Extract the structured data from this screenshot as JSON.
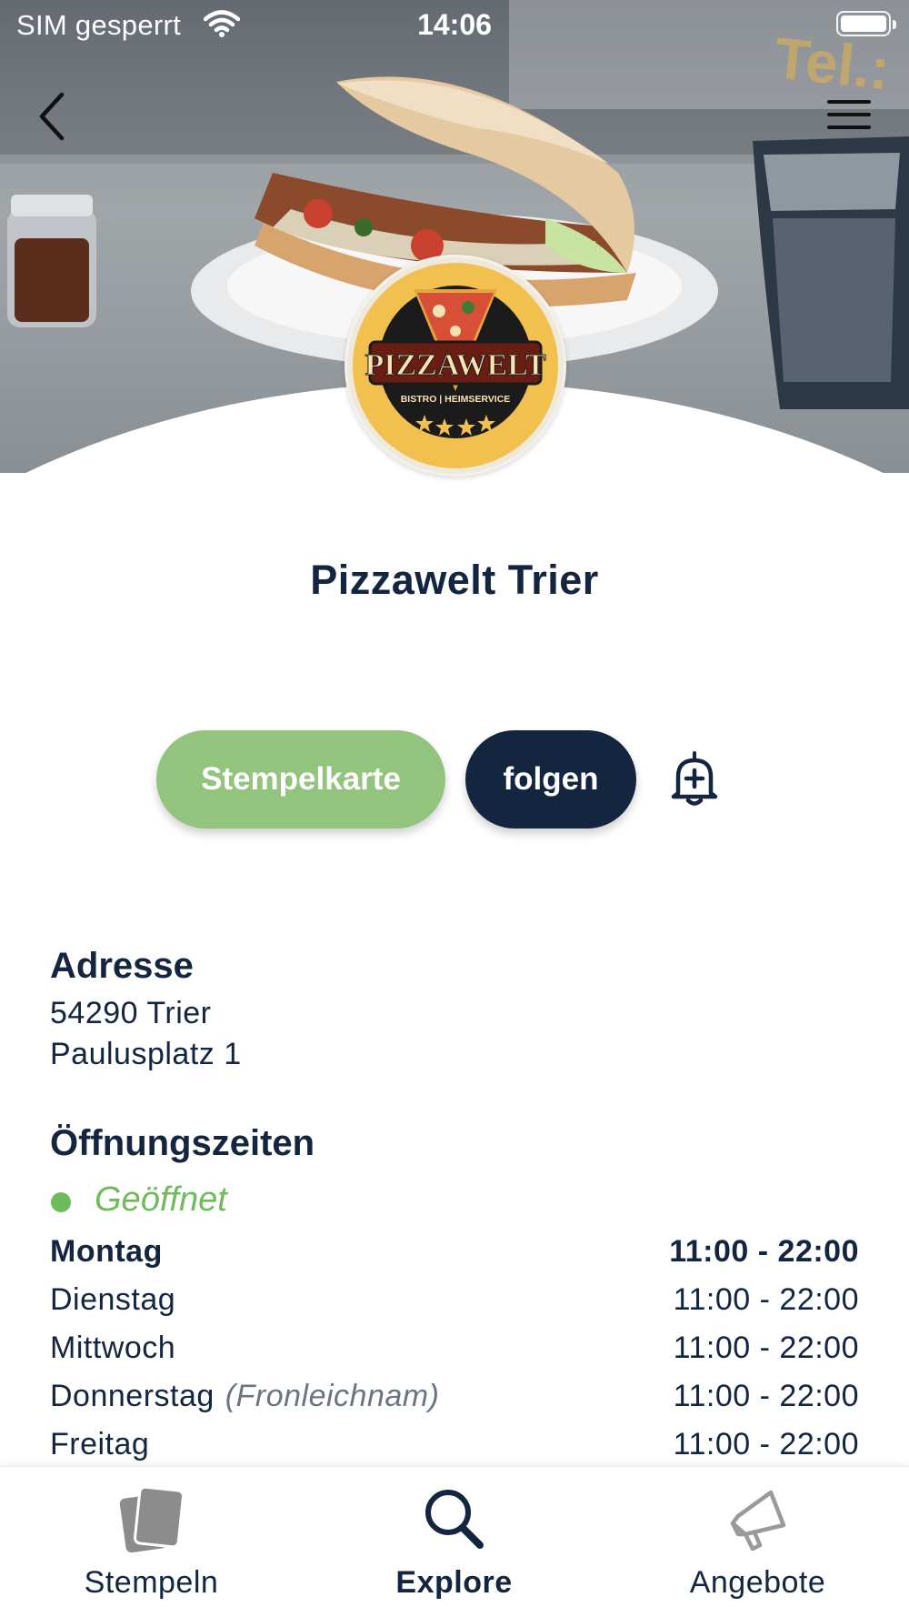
{
  "status_bar": {
    "carrier": "SIM gesperrt",
    "time": "14:06",
    "battery_level": 0.9
  },
  "nav": {
    "back_icon": "chevron-left-icon",
    "menu_icon": "hamburger-menu-icon"
  },
  "business": {
    "name": "Pizzawelt Trier",
    "logo": {
      "wordmark": "PIZZAWELT",
      "tagline": "BISTRO | HEIMSERVICE",
      "stars": 4
    }
  },
  "actions": {
    "stamp_card_label": "Stempelkarte",
    "follow_label": "folgen",
    "notify_icon": "bell-plus-icon"
  },
  "address": {
    "title": "Adresse",
    "line1": "54290 Trier",
    "line2": "Paulusplatz 1"
  },
  "opening_hours": {
    "title": "Öffnungszeiten",
    "status": "Geöffnet",
    "status_color": "#6fba5a",
    "days": [
      {
        "day": "Montag",
        "note": "",
        "hours": "11:00 - 22:00"
      },
      {
        "day": "Dienstag",
        "note": "",
        "hours": "11:00 - 22:00"
      },
      {
        "day": "Mittwoch",
        "note": "",
        "hours": "11:00 - 22:00"
      },
      {
        "day": "Donnerstag",
        "note": "(Fronleichnam)",
        "hours": "11:00 - 22:00"
      },
      {
        "day": "Freitag",
        "note": "",
        "hours": "11:00 - 22:00"
      }
    ]
  },
  "tab_bar": {
    "tabs": [
      {
        "label": "Stempeln",
        "icon": "stamp-cards-icon"
      },
      {
        "label": "Explore",
        "icon": "search-icon",
        "active": true
      },
      {
        "label": "Angebote",
        "icon": "megaphone-icon"
      }
    ]
  },
  "colors": {
    "primary_navy": "#13253f",
    "accent_green": "#93c47d",
    "open_green": "#6fba5a"
  }
}
